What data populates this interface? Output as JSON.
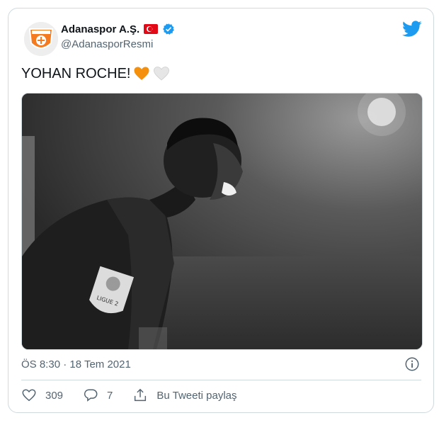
{
  "account": {
    "display_name": "Adanaspor A.Ş.",
    "handle": "@AdanasporResmi",
    "avatar_icon": "adanaspor-logo",
    "flag_icon": "turkey-flag-icon",
    "verified_icon": "verified-badge-icon"
  },
  "tweet": {
    "text": "YOHAN ROCHE!",
    "emojis": [
      "orange-heart",
      "white-heart"
    ]
  },
  "media": {
    "alt_kind": "black-and-white photo of a shouting footballer",
    "badge_text": "LIGUE 2"
  },
  "meta": {
    "timestamp": "ÖS 8:30 · 18 Tem 2021"
  },
  "actions": {
    "like_count": "309",
    "reply_count": "7",
    "share_label": "Bu Tweeti paylaş"
  },
  "colors": {
    "brand_blue": "#1d9bf0",
    "text_primary": "#0f1419",
    "text_secondary": "#536471",
    "border": "#cfd9de",
    "orange": "#f4900c"
  }
}
